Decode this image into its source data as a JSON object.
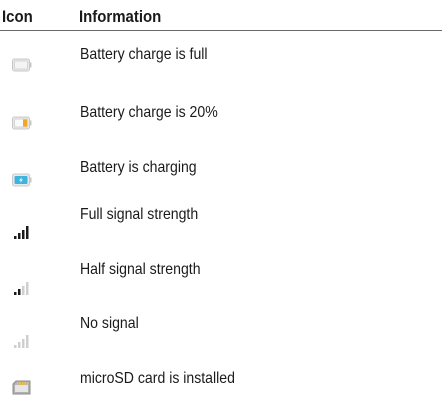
{
  "header": {
    "icon_label": "Icon",
    "info_label": "Information"
  },
  "rows": [
    {
      "icon": "battery-full-icon",
      "text": "Battery charge is full"
    },
    {
      "icon": "battery-20-icon",
      "text": "Battery charge is 20%"
    },
    {
      "icon": "battery-charging-icon",
      "text": "Battery is charging"
    },
    {
      "icon": "signal-full-icon",
      "text": "Full signal strength"
    },
    {
      "icon": "signal-half-icon",
      "text": "Half signal strength"
    },
    {
      "icon": "signal-none-icon",
      "text": "No signal"
    },
    {
      "icon": "microsd-card-icon",
      "text": "microSD card is installed"
    }
  ],
  "colors": {
    "battery_body": "#d8d8d8",
    "battery_low": "#f4a81a",
    "battery_charging": "#2aa6d6",
    "signal_active": "#1a1a1a",
    "signal_inactive": "#cfcfcf",
    "sd_card": "#9a9a9a"
  }
}
